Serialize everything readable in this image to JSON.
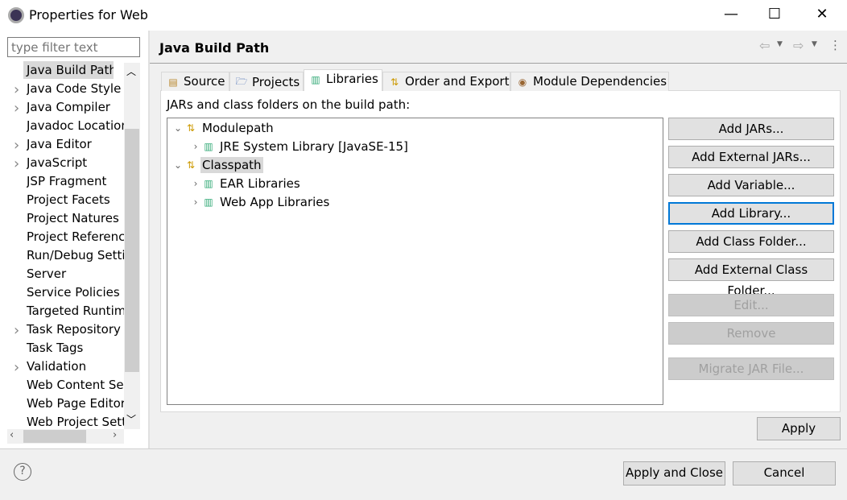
{
  "window": {
    "title": "Properties for Web",
    "minimize": "—",
    "maximize": "☐",
    "close": "✕"
  },
  "filter": {
    "placeholder": "type filter text"
  },
  "nav": [
    {
      "label": "Java Build Path",
      "expandable": false,
      "selected": true
    },
    {
      "label": "Java Code Style",
      "expandable": true
    },
    {
      "label": "Java Compiler",
      "expandable": true
    },
    {
      "label": "Javadoc Location",
      "expandable": false
    },
    {
      "label": "Java Editor",
      "expandable": true
    },
    {
      "label": "JavaScript",
      "expandable": true
    },
    {
      "label": "JSP Fragment",
      "expandable": false
    },
    {
      "label": "Project Facets",
      "expandable": false
    },
    {
      "label": "Project Natures",
      "expandable": false
    },
    {
      "label": "Project References",
      "expandable": false
    },
    {
      "label": "Run/Debug Settings",
      "expandable": false
    },
    {
      "label": "Server",
      "expandable": false
    },
    {
      "label": "Service Policies",
      "expandable": false
    },
    {
      "label": "Targeted Runtimes",
      "expandable": false
    },
    {
      "label": "Task Repository",
      "expandable": true
    },
    {
      "label": "Task Tags",
      "expandable": false
    },
    {
      "label": "Validation",
      "expandable": true
    },
    {
      "label": "Web Content Settings",
      "expandable": false
    },
    {
      "label": "Web Page Editor",
      "expandable": false
    },
    {
      "label": "Web Project Settings",
      "expandable": false
    }
  ],
  "header": {
    "title": "Java Build Path",
    "back": "⇦",
    "forward": "⇨",
    "menu": "⋮"
  },
  "tabs": [
    {
      "label": "Source",
      "icon": "source-folder-icon"
    },
    {
      "label": "Projects",
      "icon": "projects-folder-icon"
    },
    {
      "label": "Libraries",
      "icon": "library-icon",
      "active": true
    },
    {
      "label": "Order and Export",
      "icon": "order-icon"
    },
    {
      "label": "Module Dependencies",
      "icon": "module-icon"
    }
  ],
  "libraries": {
    "caption": "JARs and class folders on the build path:",
    "tree": [
      {
        "label": "Modulepath",
        "level": 0,
        "expanded": true,
        "icon": "path-icon"
      },
      {
        "label": "JRE System Library [JavaSE-15]",
        "level": 1,
        "icon": "library-icon"
      },
      {
        "label": "Classpath",
        "level": 0,
        "expanded": true,
        "icon": "path-icon",
        "selected": true
      },
      {
        "label": "EAR Libraries",
        "level": 1,
        "icon": "library-icon"
      },
      {
        "label": "Web App Libraries",
        "level": 1,
        "icon": "library-icon"
      }
    ],
    "buttons": [
      {
        "label": "Add JARs...",
        "enabled": true
      },
      {
        "label": "Add External JARs...",
        "enabled": true
      },
      {
        "label": "Add Variable...",
        "enabled": true
      },
      {
        "label": "Add Library...",
        "enabled": true,
        "focused": true
      },
      {
        "label": "Add Class Folder...",
        "enabled": true
      },
      {
        "label": "Add External Class Folder...",
        "enabled": true
      },
      {
        "label": "Edit...",
        "enabled": false
      },
      {
        "label": "Remove",
        "enabled": false
      },
      {
        "label": "Migrate JAR File...",
        "enabled": false
      }
    ]
  },
  "apply": "Apply",
  "footer": {
    "help": "?",
    "apply_close": "Apply and Close",
    "cancel": "Cancel"
  }
}
